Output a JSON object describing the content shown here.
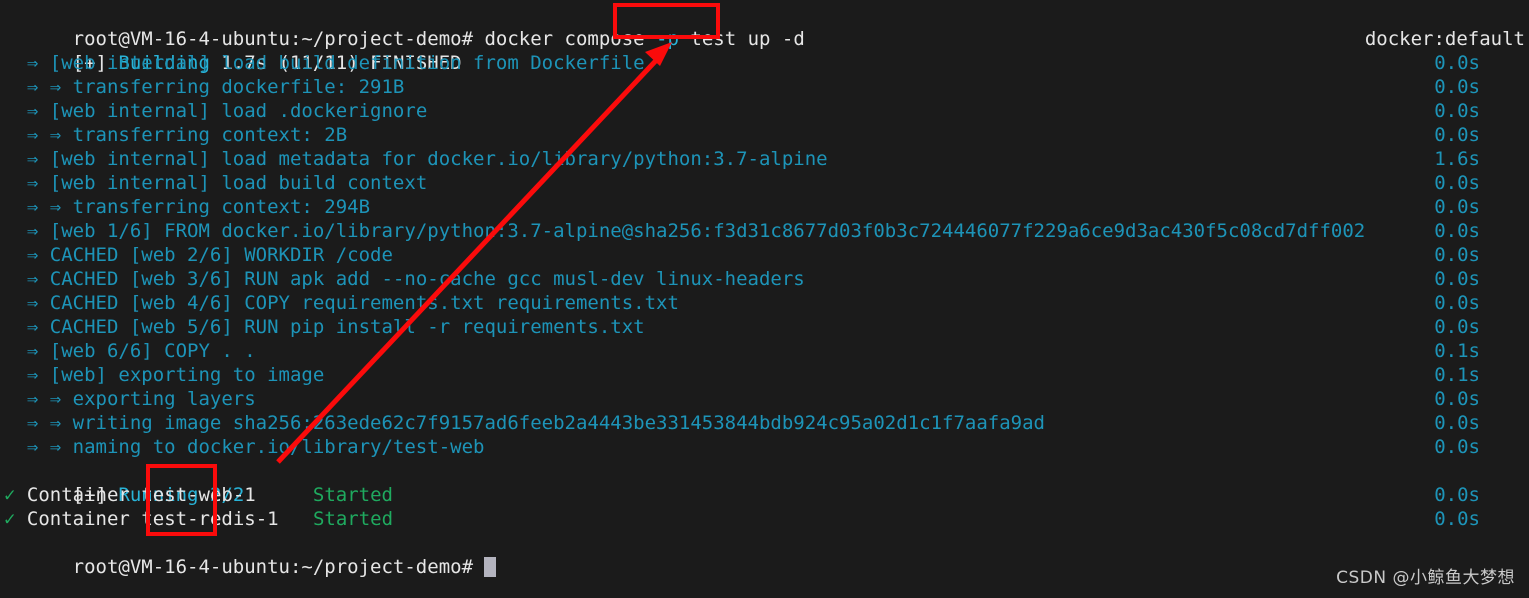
{
  "terminal": {
    "background": "#1b1b1b",
    "colors": {
      "white": "#e6e6e6",
      "cyan": "#1d94b8",
      "green": "#1faa5f",
      "annotation_red": "#fb0b0b",
      "cursor": "#b4b4bf"
    },
    "prompt_top": "root@VM-16-4-ubuntu:~/project-demo# ",
    "command": "docker compose -p test up -d",
    "command_parts": {
      "base": "docker compose ",
      "highlighted": "-p test",
      "tail": " up -d"
    },
    "build_header": {
      "marker": "[+]",
      "word": "Building",
      "rest": "1.7s (11/11) FINISHED",
      "builder": "docker:default"
    },
    "steps": [
      {
        "arrow": "=> ",
        "text": "[web internal] load build definition from Dockerfile",
        "time": "0.0s"
      },
      {
        "arrow": "=> => ",
        "text": "transferring dockerfile: 291B",
        "time": "0.0s"
      },
      {
        "arrow": "=> ",
        "text": "[web internal] load .dockerignore",
        "time": "0.0s"
      },
      {
        "arrow": "=> => ",
        "text": "transferring context: 2B",
        "time": "0.0s"
      },
      {
        "arrow": "=> ",
        "text": "[web internal] load metadata for docker.io/library/python:3.7-alpine",
        "time": "1.6s"
      },
      {
        "arrow": "=> ",
        "text": "[web internal] load build context",
        "time": "0.0s"
      },
      {
        "arrow": "=> => ",
        "text": "transferring context: 294B",
        "time": "0.0s"
      },
      {
        "arrow": "=> ",
        "text": "[web 1/6] FROM docker.io/library/python:3.7-alpine@sha256:f3d31c8677d03f0b3c724446077f229a6ce9d3ac430f5c08cd7dff002",
        "time": "0.0s"
      },
      {
        "arrow": "=> ",
        "text": "CACHED [web 2/6] WORKDIR /code",
        "time": "0.0s"
      },
      {
        "arrow": "=> ",
        "text": "CACHED [web 3/6] RUN apk add --no-cache gcc musl-dev linux-headers",
        "time": "0.0s"
      },
      {
        "arrow": "=> ",
        "text": "CACHED [web 4/6] COPY requirements.txt requirements.txt",
        "time": "0.0s"
      },
      {
        "arrow": "=> ",
        "text": "CACHED [web 5/6] RUN pip install -r requirements.txt",
        "time": "0.0s"
      },
      {
        "arrow": "=> ",
        "text": "[web 6/6] COPY . .",
        "time": "0.1s"
      },
      {
        "arrow": "=> ",
        "text": "[web] exporting to image",
        "time": "0.1s"
      },
      {
        "arrow": "=> => ",
        "text": "exporting layers",
        "time": "0.0s"
      },
      {
        "arrow": "=> => ",
        "text": "writing image sha256:263ede62c7f9157ad6feeb2a4443be331453844bdb924c95a02d1c1f7aafa9ad",
        "time": "0.0s"
      },
      {
        "arrow": "=> => ",
        "text": "naming to docker.io/library/test-web",
        "time": "0.0s"
      }
    ],
    "running_header": {
      "marker": "[+]",
      "word": "Running",
      "rest": "2/2"
    },
    "containers": [
      {
        "check": "✓",
        "label": "Container",
        "name": "test-web-1",
        "pad": "   ",
        "status": "Started",
        "time": "0.0s"
      },
      {
        "check": "✓",
        "label": "Container",
        "name": "test-redis-1",
        "pad": " ",
        "status": "Started",
        "time": "0.0s"
      }
    ],
    "prompt_bottom": "root@VM-16-4-ubuntu:~/project-demo# "
  },
  "annotations": {
    "box_command": {
      "label": "-p test"
    },
    "box_project": {
      "label": "test-"
    },
    "arrow": {
      "label": "pointer-arrow"
    }
  },
  "watermark": {
    "text": "CSDN @小鲸鱼大梦想"
  }
}
